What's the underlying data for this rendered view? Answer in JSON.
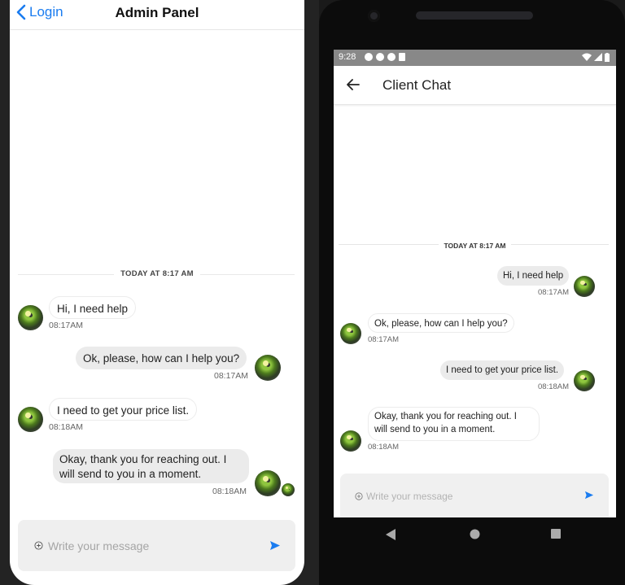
{
  "ios": {
    "back_label": "Login",
    "title": "Admin Panel",
    "date_separator": "TODAY AT 8:17 AM",
    "messages": [
      {
        "text": "Hi, I need help",
        "time": "08:17AM"
      },
      {
        "text": "Ok, please, how can I help you?",
        "time": "08:17AM"
      },
      {
        "text": "I need to get your price list.",
        "time": "08:18AM"
      },
      {
        "text_line1": "Okay, thank you for reaching out. I",
        "text_line2": "will send to you in a moment.",
        "time": "08:18AM"
      }
    ],
    "input_placeholder": "Write your message"
  },
  "android": {
    "status_time": "9:28",
    "title": "Client Chat",
    "date_separator": "TODAY AT 8:17 AM",
    "messages": [
      {
        "text": "Hi, I need help",
        "time": "08:17AM"
      },
      {
        "text": "Ok, please, how can I help you?",
        "time": "08:17AM"
      },
      {
        "text": "I need to get your price list.",
        "time": "08:18AM"
      },
      {
        "text_line1": "Okay, thank you for reaching out. I",
        "text_line2": "will send to you in a moment.",
        "time": "08:18AM"
      }
    ],
    "input_placeholder": "Write your message"
  },
  "colors": {
    "accent": "#1a7cf0",
    "bubble_gray": "#ebebeb"
  },
  "icons": [
    "chevron-left-icon",
    "arrow-left-icon",
    "add-circle-icon",
    "send-icon",
    "avatar-frog-image"
  ]
}
